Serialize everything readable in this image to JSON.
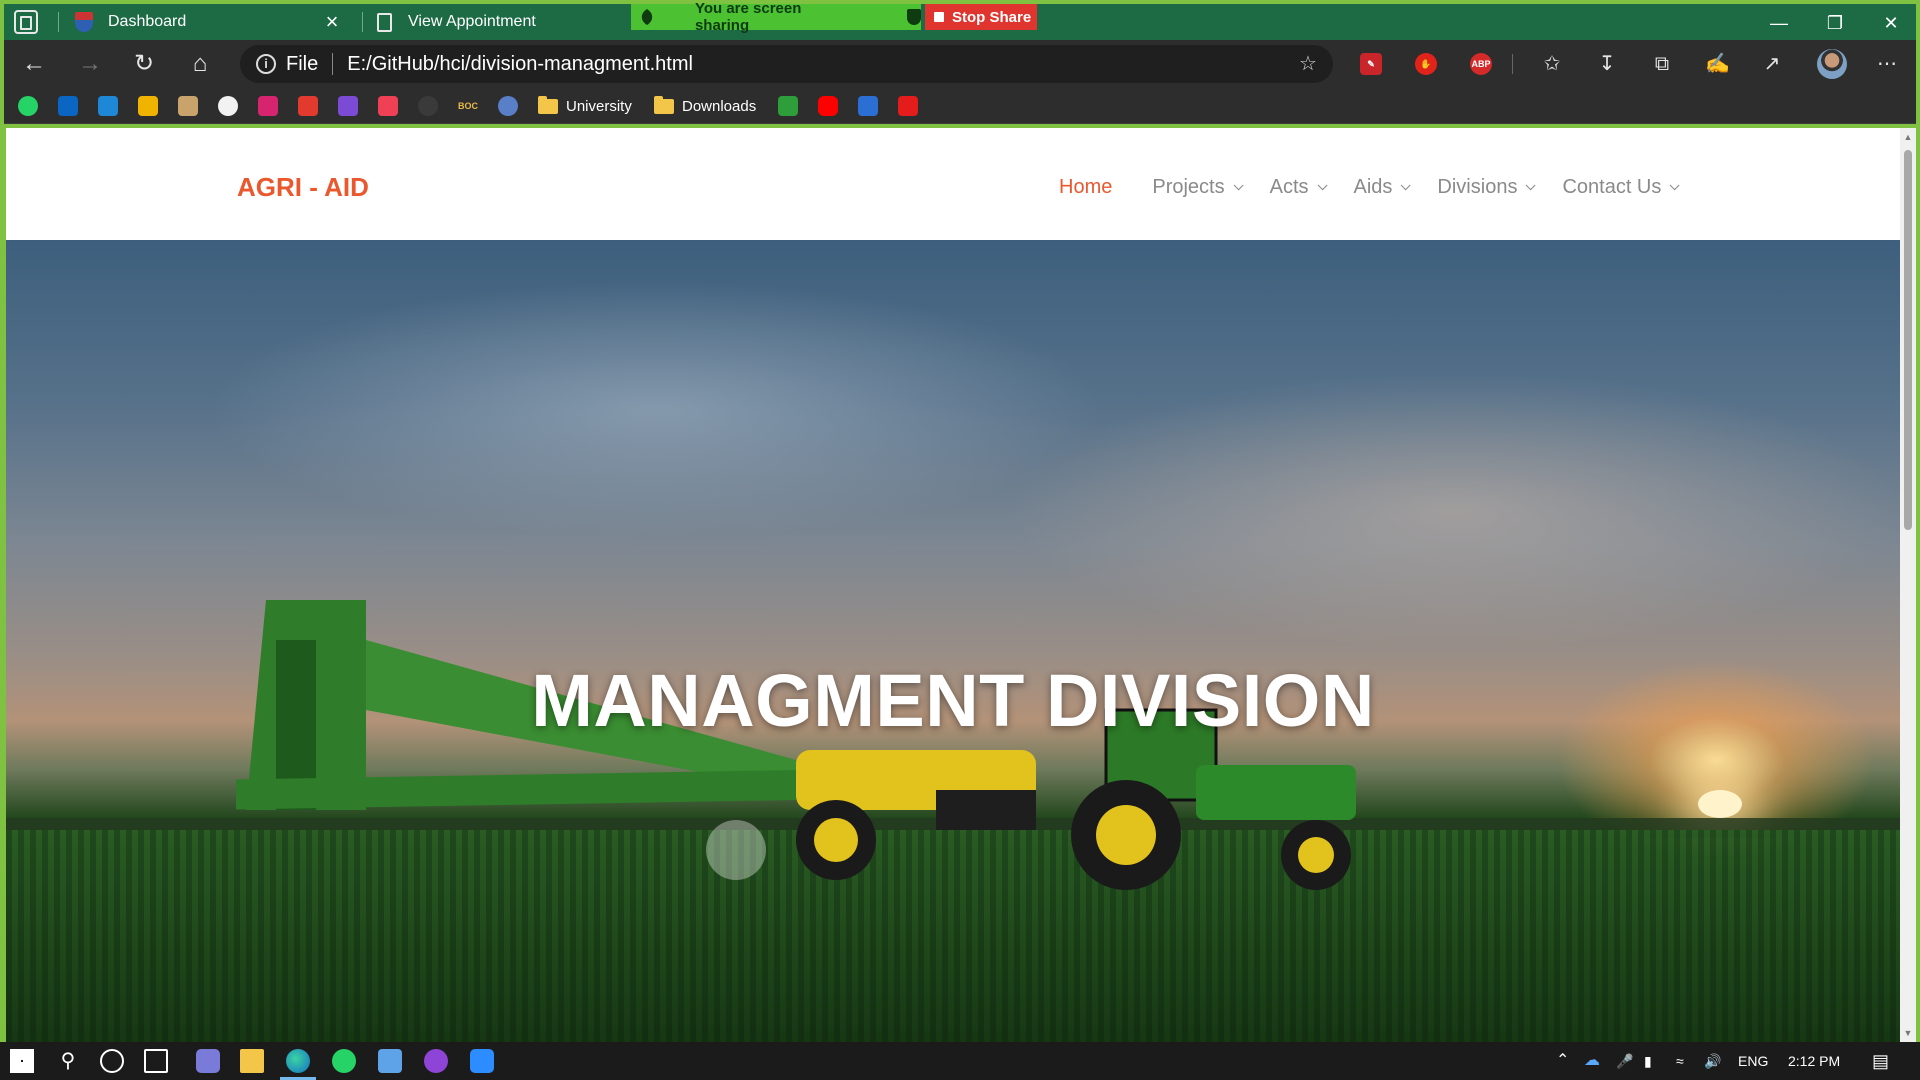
{
  "browser": {
    "tabs": [
      {
        "label": "Dashboard"
      },
      {
        "label": "View Appointment"
      }
    ],
    "screen_share": {
      "banner_text": "You are screen sharing",
      "stop_label": "Stop Share"
    },
    "address": {
      "scheme_label": "File",
      "url": "E:/GitHub/hci/division-managment.html"
    },
    "extensions": {
      "abp_label": "ABP"
    },
    "bookmarks": {
      "folders": [
        "University",
        "Downloads"
      ],
      "boc_label": "BOC"
    }
  },
  "site": {
    "logo": "AGRI - AID",
    "nav": [
      {
        "label": "Home",
        "active": true
      },
      {
        "label": "Projects"
      },
      {
        "label": "Acts"
      },
      {
        "label": "Aids"
      },
      {
        "label": "Divisions"
      },
      {
        "label": "Contact Us"
      }
    ],
    "hero_title": "MANAGMENT DIVISION"
  },
  "taskbar": {
    "language": "ENG",
    "time": "2:12 PM"
  },
  "colors": {
    "brand_orange": "#e9592d",
    "browser_frame_green": "#1d6b45",
    "share_green": "#4cc232",
    "stop_red": "#e0352f",
    "nav_gray": "#8a8a8a"
  }
}
